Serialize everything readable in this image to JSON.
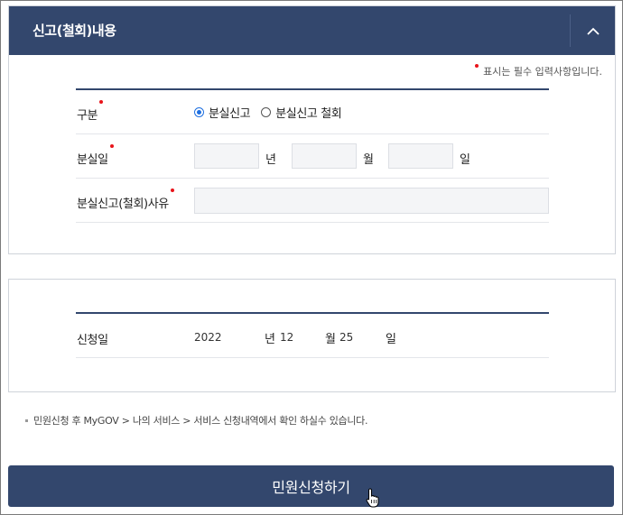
{
  "panel": {
    "title": "신고(철회)내용",
    "collapse_icon": "chevron-up-icon"
  },
  "required_note": "표시는 필수 입력사항입니다.",
  "form": {
    "type_label": "구분",
    "type_options": [
      "분실신고",
      "분실신고 철회"
    ],
    "type_selected": "분실신고",
    "lost_date_label": "분실일",
    "year_unit": "년",
    "month_unit": "월",
    "day_unit": "일",
    "year_value": "",
    "month_value": "",
    "day_value": "",
    "reason_label": "분실신고(철회)사유",
    "reason_value": ""
  },
  "application": {
    "label": "신청일",
    "year": "2022",
    "year_unit": "년",
    "month": "12",
    "month_unit": "월",
    "day": "25",
    "day_unit": "일"
  },
  "notice": "민원신청 후 MyGOV > 나의 서비스 > 서비스 신청내역에서 확인 하실수 있습니다.",
  "submit_label": "민원신청하기",
  "colors": {
    "header_bg": "#33476d",
    "required_dot": "#e8141a",
    "radio_accent": "#1e6fe0"
  }
}
